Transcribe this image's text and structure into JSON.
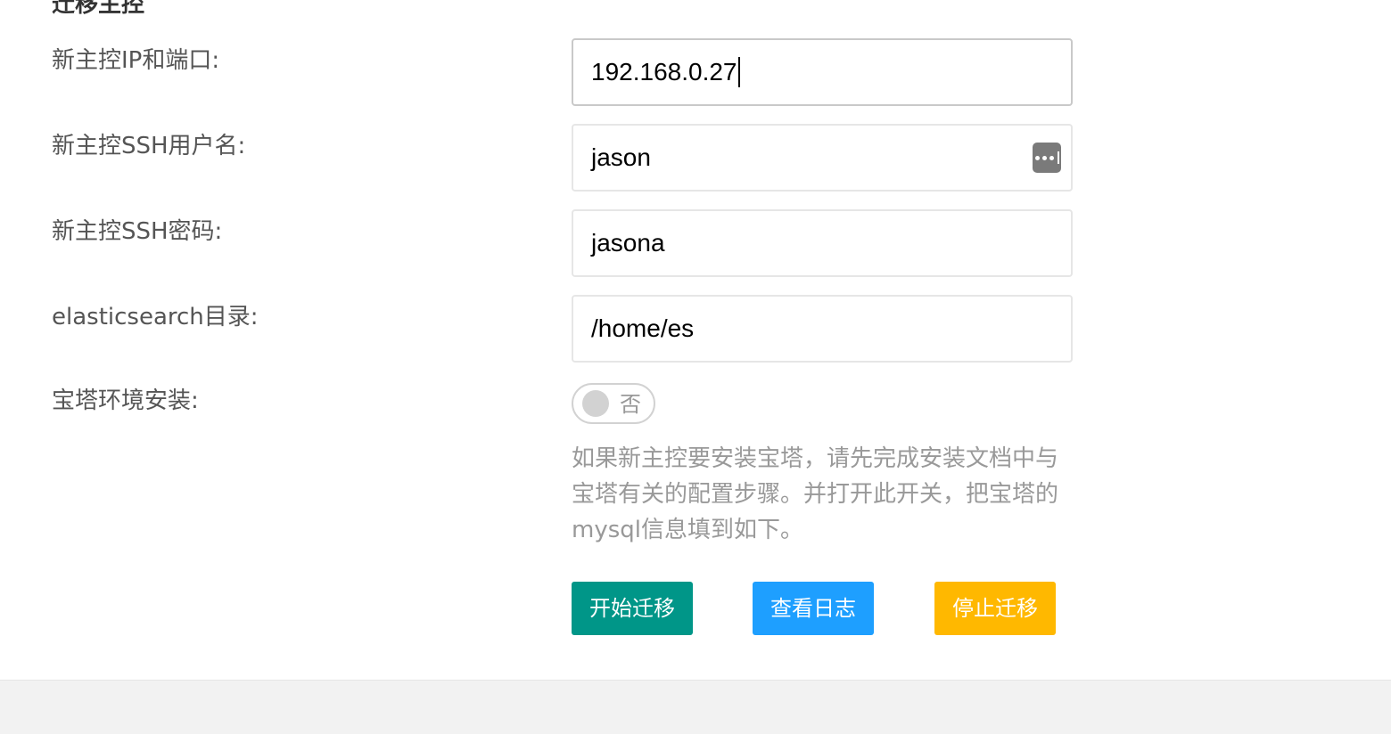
{
  "section": {
    "title": "迁移主控"
  },
  "form": {
    "ip_port": {
      "label": "新主控IP和端口:",
      "value": "192.168.0.27"
    },
    "ssh_user": {
      "label": "新主控SSH用户名:",
      "value": "jason",
      "autofill_icon": "password-manager-icon"
    },
    "ssh_password": {
      "label": "新主控SSH密码:",
      "value": "jasona"
    },
    "es_dir": {
      "label": "elasticsearch目录:",
      "value": "/home/es"
    },
    "baota": {
      "label": "宝塔环境安装:",
      "switch_text": "否",
      "checked": false
    },
    "hint": "如果新主控要安装宝塔，请先完成安装文档中与宝塔有关的配置步骤。并打开此开关，把宝塔的mysql信息填到如下。"
  },
  "buttons": {
    "start": "开始迁移",
    "view_log": "查看日志",
    "stop": "停止迁移"
  },
  "colors": {
    "start_button": "#009688",
    "log_button": "#1e9fff",
    "stop_button": "#ffb800",
    "hint_text": "#999999",
    "footer_bg": "#f2f2f2"
  }
}
